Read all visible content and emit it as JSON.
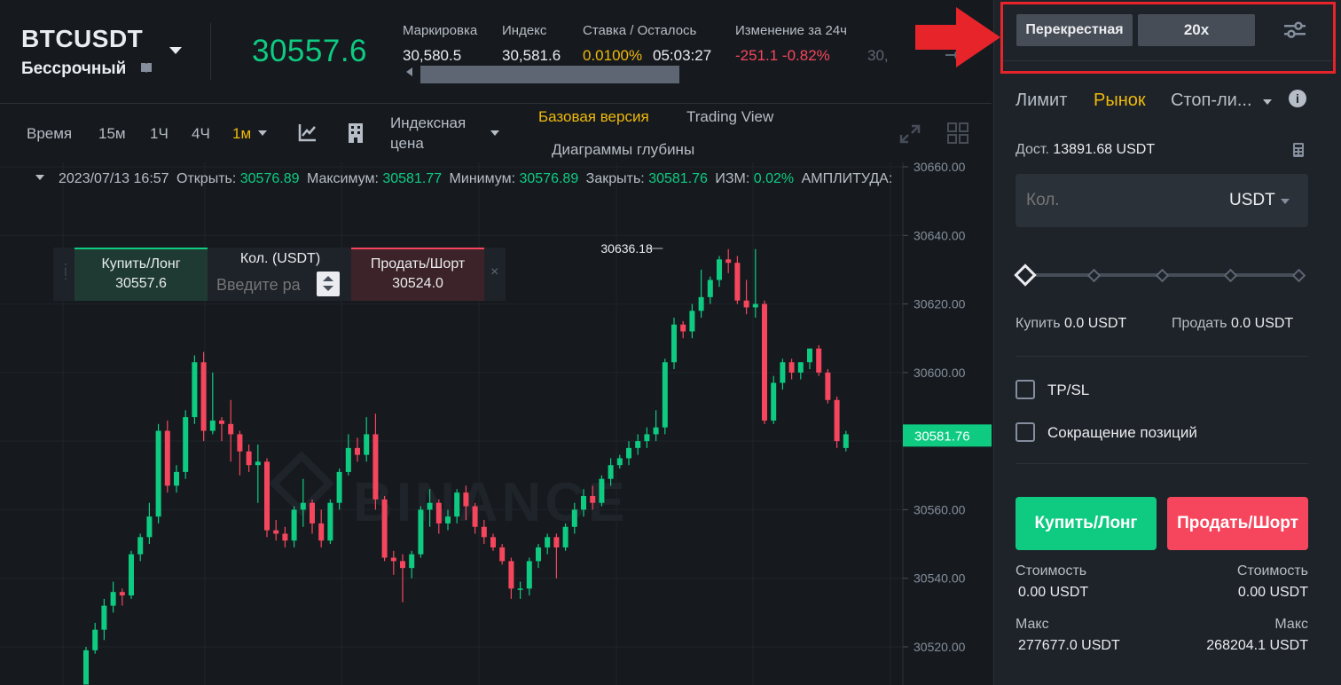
{
  "ticker": {
    "symbol": "BTCUSDT",
    "contract": "Бессрочный",
    "last_price": "30557.6",
    "stats": [
      {
        "label": "Маркировка",
        "value": "30,580.5"
      },
      {
        "label": "Индекс",
        "value": "30,581.6"
      },
      {
        "label": "Ставка / Осталось",
        "value": "0.0100%",
        "extra": "05:03:27"
      },
      {
        "label": "Изменение за 24ч",
        "value": "-251.1 -0.82%"
      }
    ],
    "truncated": "30,"
  },
  "toolbar": {
    "time": "Время",
    "intervals": [
      "15м",
      "1Ч",
      "4Ч",
      "1м"
    ],
    "price_type_line1": "Индексная",
    "price_type_line2": "цена",
    "views": [
      "Базовая версия",
      "Trading View",
      "Диаграммы глубины"
    ]
  },
  "ohlc": {
    "date": "2023/07/13 16:57",
    "open_label": "Открыть:",
    "open": "30576.89",
    "high_label": "Максимум:",
    "high": "30581.77",
    "low_label": "Минимум:",
    "low": "30576.89",
    "close_label": "Закрыть:",
    "close": "30581.76",
    "chg_label": "ИЗМ:",
    "chg": "0.02%",
    "amp_label": "АМПЛИТУДА:"
  },
  "quick_trade": {
    "buy_label": "Купить/Лонг",
    "buy_price": "30557.6",
    "qty_label": "Кол. (USDT)",
    "qty_placeholder": "Введите ра",
    "sell_label": "Продать/Шорт",
    "sell_price": "30524.0",
    "close": "×"
  },
  "watermark": "BINANCE",
  "chart_data": {
    "type": "candlestick",
    "y_ticks": [
      30520,
      30540,
      30560,
      30580,
      30600,
      30620,
      30640,
      30660
    ],
    "y_tick_labels": [
      "30520.00",
      "30540.00",
      "30560.00",
      "30580.00",
      "30600.00",
      "30620.00",
      "30640.00",
      "30660.00"
    ],
    "ylim": [
      30509,
      30662
    ],
    "current_price_label": "30581.76",
    "current_price": 30581.76,
    "high_marker_label": "30636.18",
    "high_marker_value": 30636.18,
    "high_marker_index": 62,
    "colors": {
      "up": "#0ecb81",
      "down": "#f6465d"
    },
    "candles": [
      {
        "o": 30509,
        "h": 30520,
        "l": 30509,
        "c": 30519
      },
      {
        "o": 30519,
        "h": 30527,
        "l": 30518,
        "c": 30525
      },
      {
        "o": 30525,
        "h": 30534,
        "l": 30522,
        "c": 30532
      },
      {
        "o": 30532,
        "h": 30539,
        "l": 30530,
        "c": 30536
      },
      {
        "o": 30536,
        "h": 30537,
        "l": 30532,
        "c": 30535
      },
      {
        "o": 30535,
        "h": 30548,
        "l": 30534,
        "c": 30547
      },
      {
        "o": 30547,
        "h": 30553,
        "l": 30545,
        "c": 30552
      },
      {
        "o": 30552,
        "h": 30562,
        "l": 30550,
        "c": 30558
      },
      {
        "o": 30558,
        "h": 30585,
        "l": 30556,
        "c": 30583
      },
      {
        "o": 30583,
        "h": 30586,
        "l": 30565,
        "c": 30567
      },
      {
        "o": 30567,
        "h": 30573,
        "l": 30565,
        "c": 30571
      },
      {
        "o": 30571,
        "h": 30589,
        "l": 30569,
        "c": 30587
      },
      {
        "o": 30587,
        "h": 30605,
        "l": 30585,
        "c": 30603
      },
      {
        "o": 30603,
        "h": 30606,
        "l": 30580,
        "c": 30583
      },
      {
        "o": 30583,
        "h": 30600,
        "l": 30582,
        "c": 30586
      },
      {
        "o": 30586,
        "h": 30587,
        "l": 30580,
        "c": 30585
      },
      {
        "o": 30585,
        "h": 30592,
        "l": 30574,
        "c": 30582
      },
      {
        "o": 30582,
        "h": 30583,
        "l": 30570,
        "c": 30577
      },
      {
        "o": 30577,
        "h": 30579,
        "l": 30571,
        "c": 30573
      },
      {
        "o": 30573,
        "h": 30579,
        "l": 30562,
        "c": 30574
      },
      {
        "o": 30574,
        "h": 30575,
        "l": 30552,
        "c": 30554
      },
      {
        "o": 30554,
        "h": 30557,
        "l": 30551,
        "c": 30553
      },
      {
        "o": 30553,
        "h": 30555,
        "l": 30549,
        "c": 30551
      },
      {
        "o": 30551,
        "h": 30561,
        "l": 30549,
        "c": 30560
      },
      {
        "o": 30560,
        "h": 30569,
        "l": 30555,
        "c": 30562
      },
      {
        "o": 30562,
        "h": 30563,
        "l": 30553,
        "c": 30556
      },
      {
        "o": 30556,
        "h": 30560,
        "l": 30549,
        "c": 30551
      },
      {
        "o": 30551,
        "h": 30563,
        "l": 30550,
        "c": 30562
      },
      {
        "o": 30562,
        "h": 30572,
        "l": 30560,
        "c": 30571
      },
      {
        "o": 30571,
        "h": 30582,
        "l": 30570,
        "c": 30578
      },
      {
        "o": 30578,
        "h": 30581,
        "l": 30574,
        "c": 30576
      },
      {
        "o": 30576,
        "h": 30587,
        "l": 30574,
        "c": 30582
      },
      {
        "o": 30582,
        "h": 30588,
        "l": 30560,
        "c": 30563
      },
      {
        "o": 30563,
        "h": 30564,
        "l": 30545,
        "c": 30546
      },
      {
        "o": 30546,
        "h": 30548,
        "l": 30541,
        "c": 30545
      },
      {
        "o": 30545,
        "h": 30547,
        "l": 30533,
        "c": 30543
      },
      {
        "o": 30543,
        "h": 30548,
        "l": 30540,
        "c": 30547
      },
      {
        "o": 30547,
        "h": 30561,
        "l": 30546,
        "c": 30560
      },
      {
        "o": 30560,
        "h": 30566,
        "l": 30555,
        "c": 30562
      },
      {
        "o": 30562,
        "h": 30563,
        "l": 30553,
        "c": 30556
      },
      {
        "o": 30556,
        "h": 30560,
        "l": 30554,
        "c": 30558
      },
      {
        "o": 30558,
        "h": 30566,
        "l": 30556,
        "c": 30565
      },
      {
        "o": 30565,
        "h": 30567,
        "l": 30557,
        "c": 30561
      },
      {
        "o": 30561,
        "h": 30562,
        "l": 30553,
        "c": 30555
      },
      {
        "o": 30555,
        "h": 30557,
        "l": 30550,
        "c": 30552
      },
      {
        "o": 30552,
        "h": 30553,
        "l": 30548,
        "c": 30549
      },
      {
        "o": 30549,
        "h": 30550,
        "l": 30544,
        "c": 30545
      },
      {
        "o": 30545,
        "h": 30546,
        "l": 30534,
        "c": 30537
      },
      {
        "o": 30537,
        "h": 30539,
        "l": 30534,
        "c": 30537
      },
      {
        "o": 30537,
        "h": 30546,
        "l": 30535,
        "c": 30545
      },
      {
        "o": 30545,
        "h": 30550,
        "l": 30543,
        "c": 30549
      },
      {
        "o": 30549,
        "h": 30553,
        "l": 30547,
        "c": 30552
      },
      {
        "o": 30552,
        "h": 30553,
        "l": 30540,
        "c": 30549
      },
      {
        "o": 30549,
        "h": 30556,
        "l": 30548,
        "c": 30555
      },
      {
        "o": 30555,
        "h": 30562,
        "l": 30553,
        "c": 30560
      },
      {
        "o": 30560,
        "h": 30566,
        "l": 30558,
        "c": 30564
      },
      {
        "o": 30564,
        "h": 30567,
        "l": 30560,
        "c": 30562
      },
      {
        "o": 30562,
        "h": 30570,
        "l": 30561,
        "c": 30569
      },
      {
        "o": 30569,
        "h": 30575,
        "l": 30567,
        "c": 30573
      },
      {
        "o": 30573,
        "h": 30576,
        "l": 30572,
        "c": 30575
      },
      {
        "o": 30575,
        "h": 30580,
        "l": 30573,
        "c": 30578
      },
      {
        "o": 30578,
        "h": 30582,
        "l": 30576,
        "c": 30580
      },
      {
        "o": 30580,
        "h": 30584,
        "l": 30578,
        "c": 30582
      },
      {
        "o": 30582,
        "h": 30589,
        "l": 30580,
        "c": 30584
      },
      {
        "o": 30584,
        "h": 30604,
        "l": 30582,
        "c": 30603
      },
      {
        "o": 30603,
        "h": 30616,
        "l": 30601,
        "c": 30614
      },
      {
        "o": 30614,
        "h": 30615,
        "l": 30610,
        "c": 30612
      },
      {
        "o": 30612,
        "h": 30620,
        "l": 30610,
        "c": 30618
      },
      {
        "o": 30618,
        "h": 30630,
        "l": 30616,
        "c": 30622
      },
      {
        "o": 30622,
        "h": 30628,
        "l": 30620,
        "c": 30627
      },
      {
        "o": 30627,
        "h": 30634,
        "l": 30625,
        "c": 30633
      },
      {
        "o": 30633,
        "h": 30636,
        "l": 30629,
        "c": 30632
      },
      {
        "o": 30632,
        "h": 30634,
        "l": 30620,
        "c": 30621
      },
      {
        "o": 30621,
        "h": 30627,
        "l": 30617,
        "c": 30619
      },
      {
        "o": 30619,
        "h": 30636,
        "l": 30616,
        "c": 30620
      },
      {
        "o": 30620,
        "h": 30621,
        "l": 30585,
        "c": 30586
      },
      {
        "o": 30586,
        "h": 30599,
        "l": 30585,
        "c": 30597
      },
      {
        "o": 30597,
        "h": 30604,
        "l": 30595,
        "c": 30603
      },
      {
        "o": 30603,
        "h": 30604,
        "l": 30598,
        "c": 30600
      },
      {
        "o": 30600,
        "h": 30603,
        "l": 30598,
        "c": 30603
      },
      {
        "o": 30603,
        "h": 30607,
        "l": 30601,
        "c": 30607
      },
      {
        "o": 30607,
        "h": 30608,
        "l": 30599,
        "c": 30600
      },
      {
        "o": 30600,
        "h": 30601,
        "l": 30591,
        "c": 30592
      },
      {
        "o": 30592,
        "h": 30593,
        "l": 30578,
        "c": 30580
      },
      {
        "o": 30578,
        "h": 30583,
        "l": 30577,
        "c": 30582
      }
    ]
  },
  "panel": {
    "margin_mode": "Перекрестная",
    "leverage": "20x",
    "order_tabs": [
      "Лимит",
      "Рынок",
      "Стоп-ли..."
    ],
    "avail_label": "Дост.",
    "avail_value": "13891.68 USDT",
    "qty_placeholder": "Кол.",
    "qty_unit": "USDT",
    "slider_percent": 0,
    "buy_label": "Купить",
    "buy_value": "0.0 USDT",
    "sell_label": "Продать",
    "sell_value": "0.0 USDT",
    "tpsl": "TP/SL",
    "reduce_only": "Сокращение позиций",
    "buy_button": "Купить/Лонг",
    "sell_button": "Продать/Шорт",
    "cost_label": "Стоимость",
    "buy_cost": "0.00 USDT",
    "sell_cost": "0.00 USDT",
    "max_label": "Макс",
    "buy_max": "277677.0 USDT",
    "sell_max": "268204.1 USDT"
  },
  "colors": {
    "accent": "#f0b90b",
    "up": "#0ecb81",
    "down": "#f6465d",
    "highlight": "#e8242b"
  }
}
